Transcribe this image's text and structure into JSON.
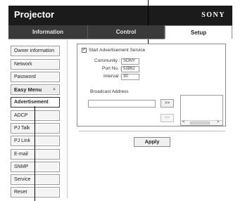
{
  "header": {
    "title": "Projector",
    "brand": "SONY"
  },
  "tabs": [
    {
      "label": "Information",
      "active": false
    },
    {
      "label": "Control",
      "active": false
    },
    {
      "label": "Setup",
      "active": true
    }
  ],
  "sidebar": {
    "items": [
      {
        "label": "Owner information"
      },
      {
        "label": "Network"
      },
      {
        "label": "Password"
      },
      {
        "label": "Easy Menu"
      },
      {
        "label": "Advertisement"
      },
      {
        "label": "ADCP"
      },
      {
        "label": "PJ Talk"
      },
      {
        "label": "PJ Link"
      },
      {
        "label": "E-mail"
      },
      {
        "label": "SNMP"
      },
      {
        "label": "Service"
      },
      {
        "label": "Reset"
      }
    ]
  },
  "advertisement": {
    "start_label": "Start Advertisement Service",
    "start_checked": true,
    "checkmark": "✓",
    "community_label": "Community :",
    "community_value": "SONY",
    "port_label": "Port No. :",
    "port_value": "53862",
    "interval_label": "Interval :",
    "interval_value": "30",
    "broadcast_label": "Broadcast Address",
    "broadcast_value": "",
    "add_button": ">>",
    "remove_button": "<<",
    "scroll_left": "<",
    "scroll_right": ">"
  },
  "apply_label": "Apply",
  "icons": {
    "collapse": "up-chevron-icon"
  }
}
